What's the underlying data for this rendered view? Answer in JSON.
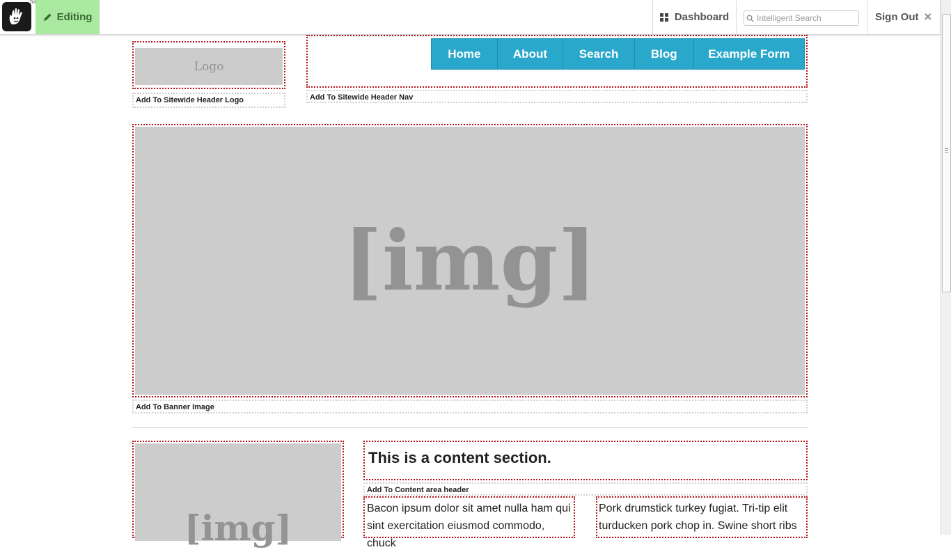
{
  "toolbar": {
    "logo_trademark": "TM",
    "editing_label": "Editing",
    "dashboard_label": "Dashboard",
    "search_placeholder": "Intelligent Search",
    "signout_label": "Sign Out",
    "signout_close_glyph": "×",
    "accent_color": "#a9e9a0"
  },
  "header": {
    "logo_text": "Logo",
    "add_logo_label": "Add To Sitewide Header Logo",
    "nav_items": [
      "Home",
      "About",
      "Search",
      "Blog",
      "Example Form"
    ],
    "add_nav_label": "Add To Sitewide Header Nav",
    "nav_color": "#2aa8cb"
  },
  "banner": {
    "placeholder_text": "[img]",
    "add_label": "Add To Banner Image"
  },
  "content": {
    "side_image_text": "[img]",
    "heading": "This is a content section.",
    "add_header_label": "Add To Content area header",
    "column_left_text": "Bacon ipsum dolor sit amet nulla ham qui sint exercitation eiusmod commodo, chuck",
    "column_right_text": "Pork drumstick turkey fugiat. Tri-tip elit turducken pork chop in. Swine short ribs"
  },
  "icons": {
    "logo": "hand-logo-icon",
    "editing": "pencil-icon",
    "dashboard": "grid-icon",
    "search": "search-icon",
    "signout": "close-icon"
  },
  "colors": {
    "area_border": "#b8141a",
    "placeholder_bg": "#cccccc"
  }
}
